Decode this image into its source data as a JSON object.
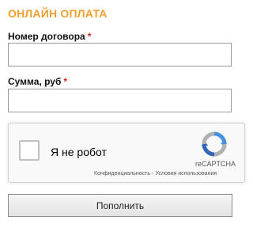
{
  "form": {
    "title": "ОНЛАЙН ОПЛАТА",
    "contract_label": "Номер договора",
    "sum_label": "Сумма, руб",
    "required_mark": "*",
    "contract_value": "",
    "sum_value": "",
    "submit_label": "Пополнить"
  },
  "captcha": {
    "label": "Я не робот",
    "brand": "reCAPTCHA",
    "privacy": "Конфиденциальность",
    "separator": "-",
    "terms": "Условия использования",
    "icon": "recaptcha-logo-icon"
  },
  "colors": {
    "title": "#f0a030",
    "required": "#dd2222",
    "recaptcha_blue": "#4a90e2",
    "recaptcha_gray": "#b0b0b0"
  }
}
